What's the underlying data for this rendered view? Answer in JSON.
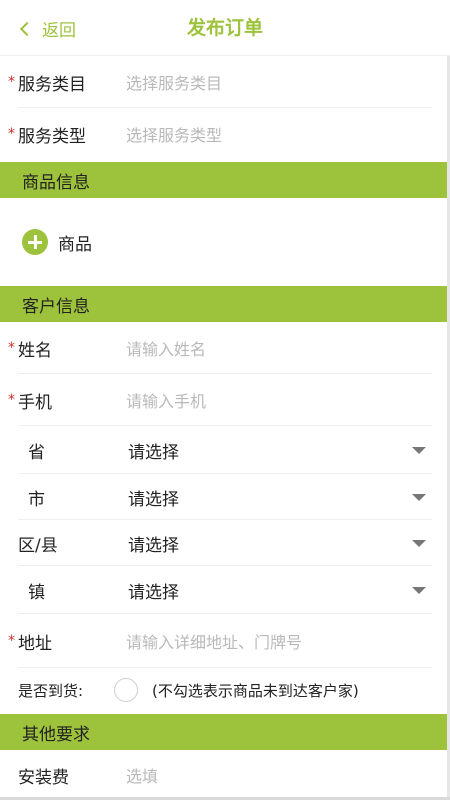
{
  "header": {
    "back_label": "返回",
    "title": "发布订单"
  },
  "fields": {
    "service_category": {
      "label": "服务类目",
      "placeholder": "选择服务类目"
    },
    "service_type": {
      "label": "服务类型",
      "placeholder": "选择服务类型"
    }
  },
  "sections": {
    "goods": "商品信息",
    "customer": "客户信息",
    "other": "其他要求"
  },
  "goods": {
    "add_label": "商品"
  },
  "customer": {
    "name": {
      "label": "姓名",
      "placeholder": "请输入姓名"
    },
    "phone": {
      "label": "手机",
      "placeholder": "请输入手机"
    },
    "province": {
      "label": "省",
      "value": "请选择"
    },
    "city": {
      "label": "市",
      "value": "请选择"
    },
    "district": {
      "label": "区/县",
      "value": "请选择"
    },
    "town": {
      "label": "镇",
      "value": "请选择"
    },
    "address": {
      "label": "地址",
      "placeholder": "请输入详细地址、门牌号"
    },
    "arrived": {
      "label": "是否到货:",
      "hint": "(不勾选表示商品未到达客户家)"
    }
  },
  "other": {
    "install_fee": {
      "label": "安装费",
      "placeholder": "选填"
    }
  },
  "required_mark": "*",
  "colors": {
    "accent": "#9dc23b",
    "required": "#d0312d",
    "placeholder": "#b9b9b9"
  }
}
